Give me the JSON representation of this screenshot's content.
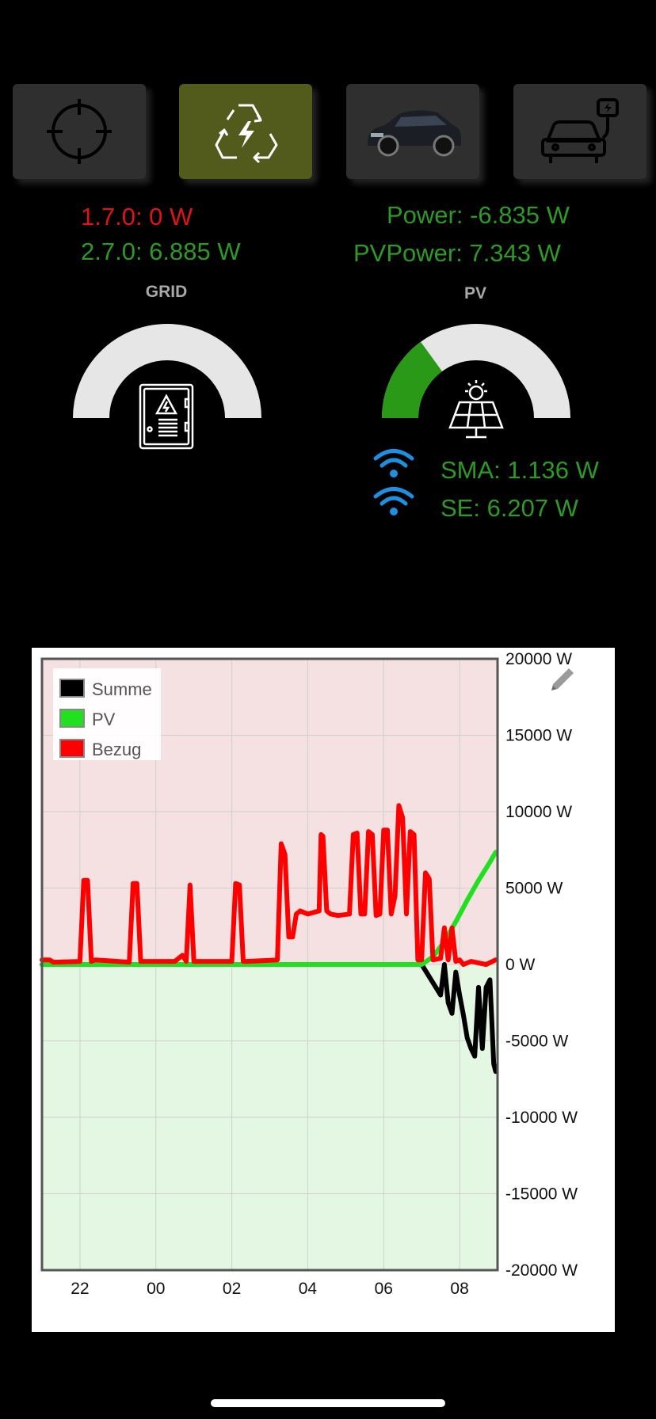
{
  "tabs": [
    {
      "name": "target"
    },
    {
      "name": "energy-recycle"
    },
    {
      "name": "car-photo"
    },
    {
      "name": "car-charging"
    }
  ],
  "grid": {
    "line1": "1.7.0: 0 W",
    "line2": "2.7.0: 6.885 W",
    "title": "GRID",
    "gauge_fraction": 0,
    "icon": "electric-cabinet-icon"
  },
  "pv": {
    "power": "Power: -6.835 W",
    "pvpower": "PVPower: 7.343 W",
    "title": "PV",
    "gauge_fraction": 0.3,
    "icon": "solar-panel-icon",
    "sma": "SMA: 1.136 W",
    "se": "SE: 6.207 W"
  },
  "colors": {
    "accent_green": "#2e9a26",
    "accent_red": "#e01414",
    "tile_active": "#525a1c",
    "wifi_blue": "#1f8fe0"
  },
  "chart_data": {
    "type": "line",
    "x_ticks": [
      "22",
      "00",
      "02",
      "04",
      "06",
      "08"
    ],
    "y_ticks": [
      "20000 W",
      "15000 W",
      "10000 W",
      "5000 W",
      "0 W",
      "-5000 W",
      "-10000 W",
      "-15000 W",
      "-20000 W"
    ],
    "ylim": [
      -20000,
      20000
    ],
    "xlim": [
      21.0,
      33.0
    ],
    "grid": true,
    "legend_position": "top-left",
    "series": [
      {
        "name": "Summe",
        "color": "#000000",
        "x": [
          21.0,
          31.0,
          31.5,
          31.6,
          31.7,
          31.8,
          31.9,
          32.0,
          32.1,
          32.2,
          32.3,
          32.4,
          32.5,
          32.6,
          32.7,
          32.8,
          32.9,
          32.95
        ],
        "y": [
          0,
          0,
          -2000,
          0,
          -2500,
          -3200,
          -500,
          -2000,
          -3300,
          -4800,
          -5500,
          -6000,
          -1500,
          -5500,
          -1500,
          -1000,
          -6500,
          -7000
        ]
      },
      {
        "name": "PV",
        "color": "#20e020",
        "x": [
          21.0,
          31.0,
          31.3,
          31.6,
          31.9,
          32.2,
          32.5,
          32.8,
          32.95
        ],
        "y": [
          0,
          0,
          500,
          1500,
          2800,
          4200,
          5500,
          6700,
          7343
        ]
      },
      {
        "name": "Bezug",
        "color": "#ff0000",
        "x": [
          21.0,
          21.2,
          21.3,
          22.0,
          22.1,
          22.2,
          22.3,
          22.4,
          23.0,
          23.3,
          23.4,
          23.5,
          23.6,
          24.5,
          24.7,
          24.8,
          24.9,
          25.0,
          25.1,
          26.0,
          26.1,
          26.2,
          26.3,
          26.4,
          27.2,
          27.3,
          27.4,
          27.5,
          27.6,
          27.7,
          27.8,
          28.0,
          28.3,
          28.35,
          28.4,
          28.5,
          28.6,
          28.8,
          29.1,
          29.2,
          29.3,
          29.4,
          29.5,
          29.6,
          29.7,
          29.8,
          29.9,
          30.0,
          30.1,
          30.2,
          30.3,
          30.4,
          30.5,
          30.6,
          30.7,
          30.8,
          30.9,
          31.0,
          31.1,
          31.2,
          31.3,
          31.5,
          31.6,
          31.7,
          31.8,
          31.9,
          32.0,
          32.1,
          32.3,
          32.5,
          32.7,
          32.95
        ],
        "y": [
          300,
          300,
          150,
          200,
          5500,
          5500,
          200,
          300,
          200,
          150,
          5300,
          5300,
          200,
          200,
          600,
          200,
          5200,
          200,
          200,
          200,
          5300,
          5200,
          200,
          200,
          300,
          7900,
          7200,
          1800,
          1800,
          3300,
          3500,
          3300,
          3500,
          8500,
          8400,
          3500,
          3300,
          3200,
          3300,
          8500,
          8600,
          3300,
          3300,
          8700,
          8500,
          3200,
          3300,
          8800,
          8800,
          3300,
          4500,
          10400,
          9600,
          3300,
          8700,
          8500,
          300,
          300,
          6000,
          5600,
          300,
          400,
          2400,
          300,
          2400,
          200,
          300,
          0,
          200,
          100,
          0,
          300
        ]
      }
    ]
  }
}
